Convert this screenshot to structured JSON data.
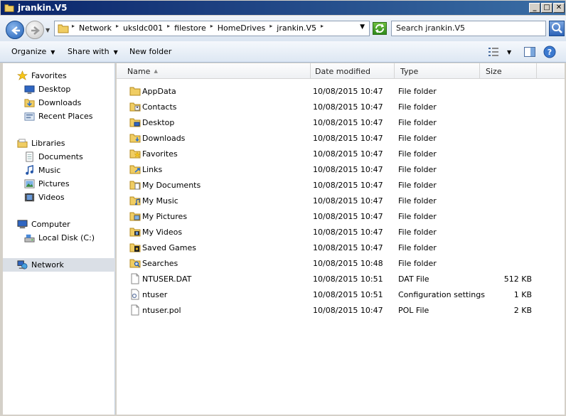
{
  "window": {
    "title": "jrankin.V5",
    "min_label": "_",
    "max_label": "□",
    "close_label": "✕"
  },
  "address": {
    "crumbs": [
      "Network",
      "uksldc001",
      "filestore",
      "HomeDrives",
      "jrankin.V5"
    ],
    "search_placeholder": "Search jrankin.V5"
  },
  "toolbar": {
    "organize": "Organize",
    "share_with": "Share with",
    "new_folder": "New folder"
  },
  "sidebar": {
    "favorites": "Favorites",
    "favorites_items": [
      "Desktop",
      "Downloads",
      "Recent Places"
    ],
    "libraries": "Libraries",
    "libraries_items": [
      "Documents",
      "Music",
      "Pictures",
      "Videos"
    ],
    "computer": "Computer",
    "computer_items": [
      "Local Disk (C:)"
    ],
    "network": "Network"
  },
  "columns": {
    "name": "Name",
    "date": "Date modified",
    "type": "Type",
    "size": "Size"
  },
  "files": [
    {
      "name": "AppData",
      "date": "10/08/2015 10:47",
      "type": "File folder",
      "size": "",
      "icon": "folder-icon"
    },
    {
      "name": "Contacts",
      "date": "10/08/2015 10:47",
      "type": "File folder",
      "size": "",
      "icon": "contacts-folder-icon"
    },
    {
      "name": "Desktop",
      "date": "10/08/2015 10:47",
      "type": "File folder",
      "size": "",
      "icon": "desktop-folder-icon"
    },
    {
      "name": "Downloads",
      "date": "10/08/2015 10:47",
      "type": "File folder",
      "size": "",
      "icon": "downloads-folder-icon"
    },
    {
      "name": "Favorites",
      "date": "10/08/2015 10:47",
      "type": "File folder",
      "size": "",
      "icon": "favorites-folder-icon"
    },
    {
      "name": "Links",
      "date": "10/08/2015 10:47",
      "type": "File folder",
      "size": "",
      "icon": "links-folder-icon"
    },
    {
      "name": "My Documents",
      "date": "10/08/2015 10:47",
      "type": "File folder",
      "size": "",
      "icon": "documents-folder-icon"
    },
    {
      "name": "My Music",
      "date": "10/08/2015 10:47",
      "type": "File folder",
      "size": "",
      "icon": "music-folder-icon"
    },
    {
      "name": "My Pictures",
      "date": "10/08/2015 10:47",
      "type": "File folder",
      "size": "",
      "icon": "pictures-folder-icon"
    },
    {
      "name": "My Videos",
      "date": "10/08/2015 10:47",
      "type": "File folder",
      "size": "",
      "icon": "videos-folder-icon"
    },
    {
      "name": "Saved Games",
      "date": "10/08/2015 10:47",
      "type": "File folder",
      "size": "",
      "icon": "games-folder-icon"
    },
    {
      "name": "Searches",
      "date": "10/08/2015 10:48",
      "type": "File folder",
      "size": "",
      "icon": "searches-folder-icon"
    },
    {
      "name": "NTUSER.DAT",
      "date": "10/08/2015 10:51",
      "type": "DAT File",
      "size": "512 KB",
      "icon": "file-icon"
    },
    {
      "name": "ntuser",
      "date": "10/08/2015 10:51",
      "type": "Configuration settings",
      "size": "1 KB",
      "icon": "config-file-icon"
    },
    {
      "name": "ntuser.pol",
      "date": "10/08/2015 10:47",
      "type": "POL File",
      "size": "2 KB",
      "icon": "file-icon"
    }
  ],
  "colors": {
    "titlebar": "#0a246a",
    "folder": "#e8c35a",
    "selected_nav": "#dadfe6"
  }
}
